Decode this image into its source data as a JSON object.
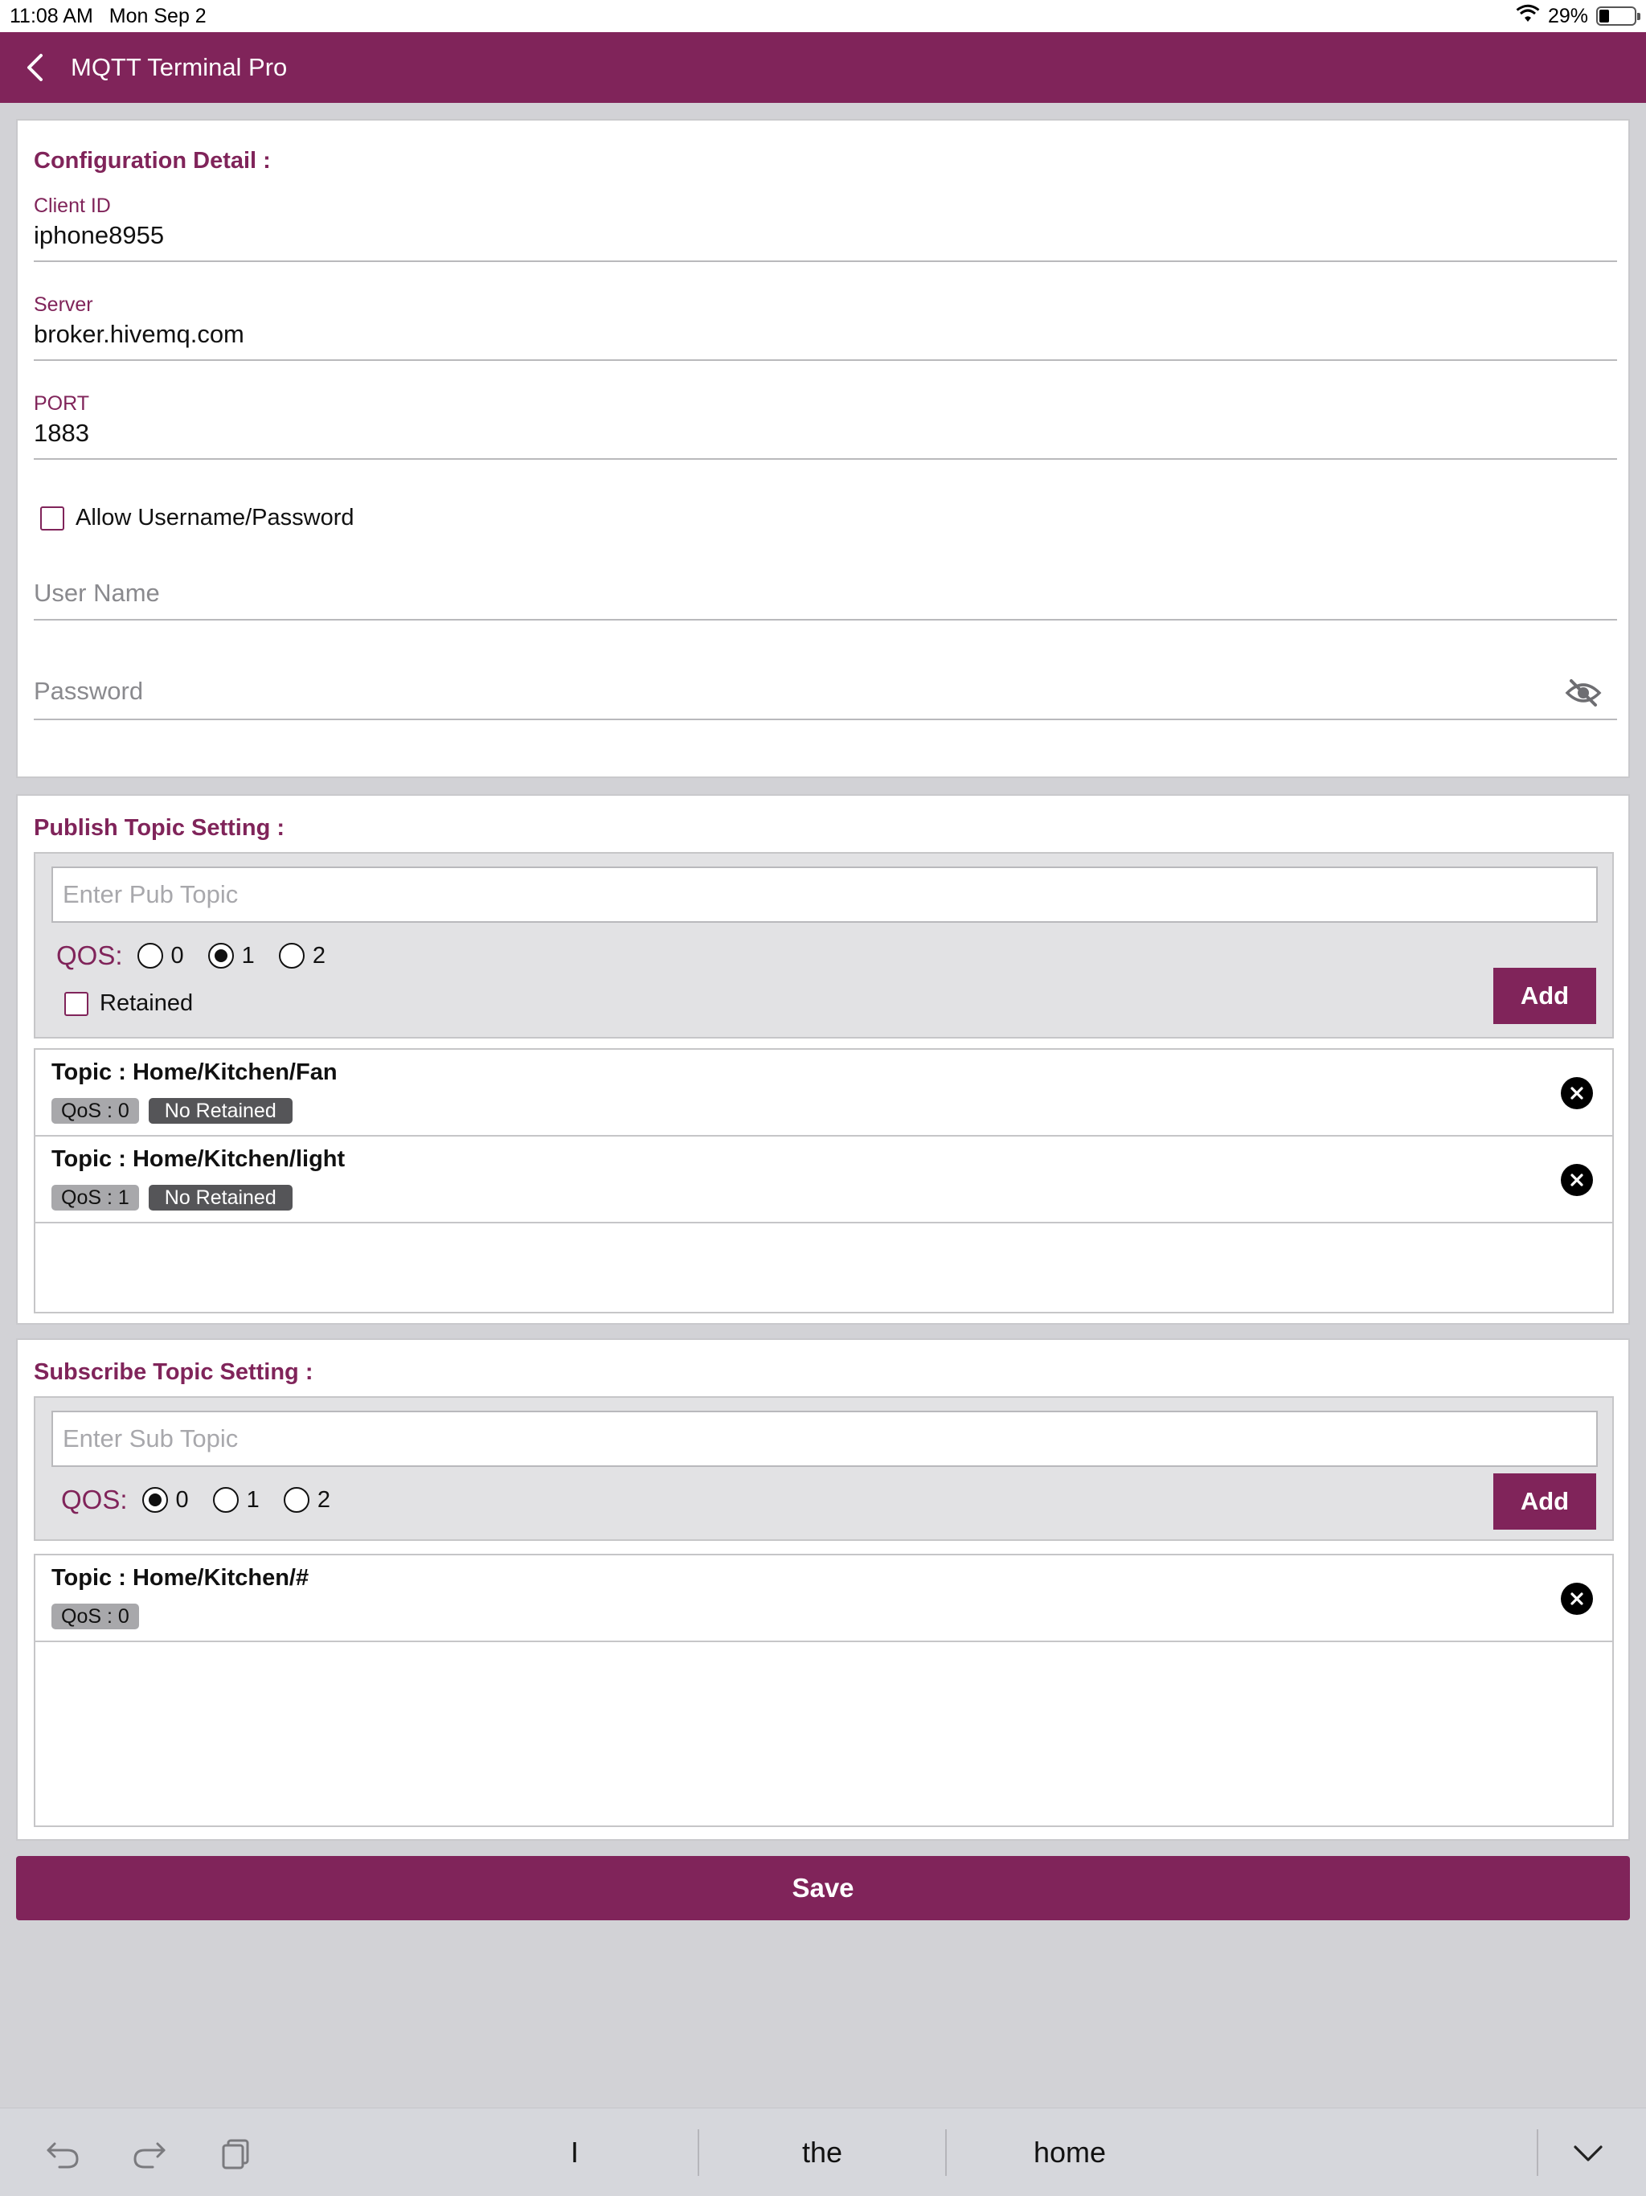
{
  "status_bar": {
    "time": "11:08 AM",
    "date": "Mon Sep 2",
    "battery": "29%"
  },
  "nav": {
    "title": "MQTT Terminal Pro"
  },
  "config": {
    "title": "Configuration Detail :",
    "client_id_label": "Client ID",
    "client_id_value": "iphone8955",
    "server_label": "Server",
    "server_value": "broker.hivemq.com",
    "port_label": "PORT",
    "port_value": "1883",
    "allow_label": "Allow Username/Password",
    "username_placeholder": "User Name",
    "password_placeholder": "Password"
  },
  "publish": {
    "title": "Publish Topic Setting :",
    "placeholder": "Enter Pub Topic",
    "qos_label": "QOS:",
    "qos_options": [
      "0",
      "1",
      "2"
    ],
    "qos_selected": "1",
    "retained_label": "Retained",
    "add_label": "Add",
    "topics": [
      {
        "topic": "Topic : Home/Kitchen/Fan",
        "qos": "QoS : 0",
        "retained": "No Retained"
      },
      {
        "topic": "Topic : Home/Kitchen/light",
        "qos": "QoS : 1",
        "retained": "No Retained"
      }
    ]
  },
  "subscribe": {
    "title": "Subscribe Topic Setting :",
    "placeholder": "Enter Sub Topic",
    "qos_label": "QOS:",
    "qos_options": [
      "0",
      "1",
      "2"
    ],
    "qos_selected": "0",
    "add_label": "Add",
    "topics": [
      {
        "topic": "Topic : Home/Kitchen/#",
        "qos": "QoS : 0"
      }
    ]
  },
  "save_label": "Save",
  "keyboard": {
    "suggestions": [
      "I",
      "the",
      "home"
    ]
  },
  "colors": {
    "brand": "#80245a",
    "background": "#d2d2d6"
  }
}
